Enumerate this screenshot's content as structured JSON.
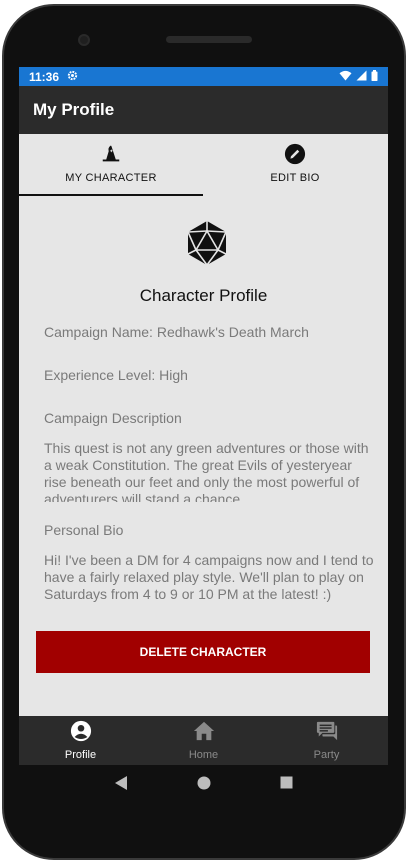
{
  "status_bar": {
    "time": "11:36"
  },
  "app_bar": {
    "title": "My Profile"
  },
  "tabs": [
    {
      "label": "MY CHARACTER",
      "icon": "wizard-hat-icon",
      "selected": true
    },
    {
      "label": "EDIT BIO",
      "icon": "pencil-circle-icon",
      "selected": false
    }
  ],
  "profile": {
    "heading": "Character Profile",
    "campaign_name": "Campaign Name: Redhawk's Death March",
    "experience_level": "Experience Level: High",
    "campaign_description_label": "Campaign Description",
    "campaign_description": "This quest is not any green adventures or those with a weak Constitution. The great Evils of yesteryear rise beneath our feet and only the most powerful of adventurers will stand a chance.",
    "personal_bio_label": "Personal Bio",
    "personal_bio": "Hi! I've been a DM for 4 campaigns now and I tend to have a fairly relaxed play style. We'll plan to play on Saturdays from 4 to 9 or 10 PM at the latest! :)"
  },
  "delete_button": {
    "label": "DELETE CHARACTER"
  },
  "bottom_nav": [
    {
      "label": "Profile",
      "icon": "account-circle-icon",
      "active": true
    },
    {
      "label": "Home",
      "icon": "home-icon",
      "active": false
    },
    {
      "label": "Party",
      "icon": "chat-bubbles-icon",
      "active": false
    }
  ],
  "colors": {
    "status_bar": "#1976d2",
    "app_bar": "#2b2b2b",
    "background": "#e6e6e6",
    "delete_button": "#a10000"
  }
}
